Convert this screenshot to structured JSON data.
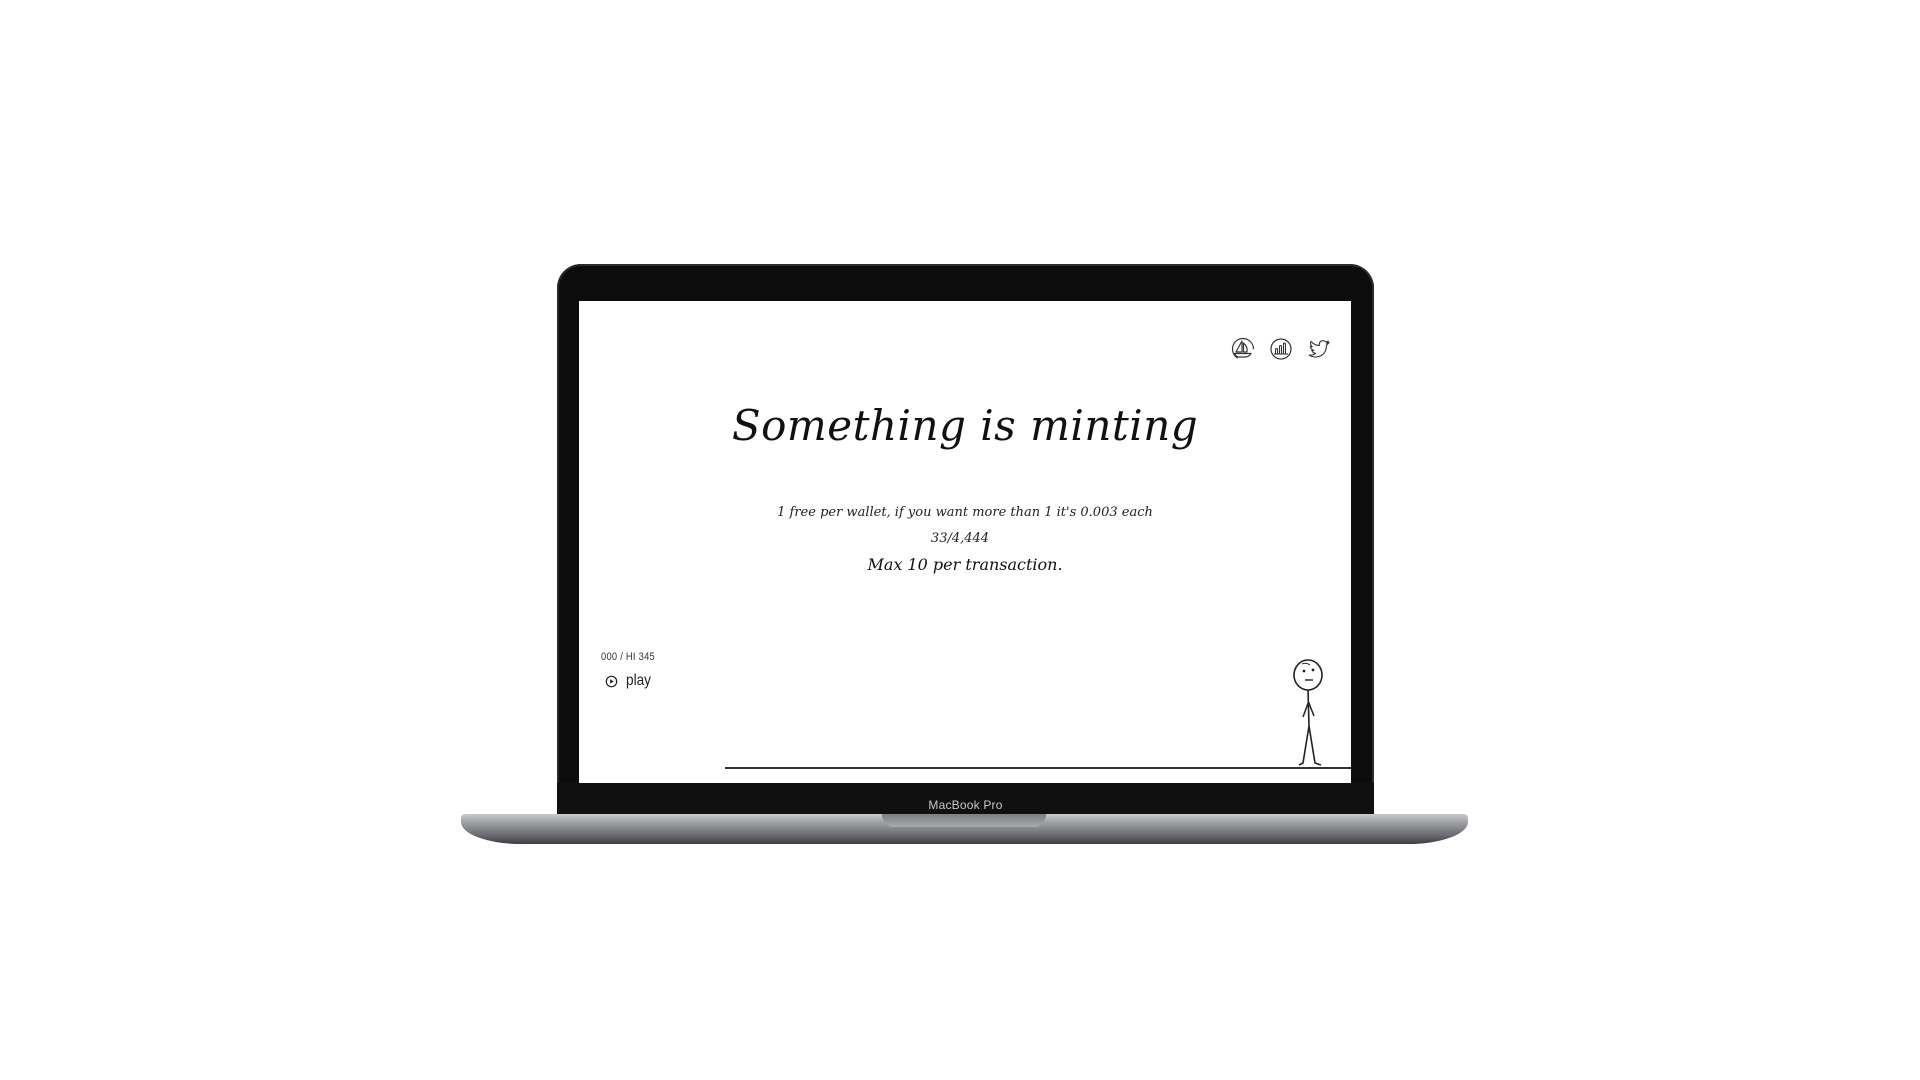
{
  "device": {
    "brand_label": "MacBook Pro"
  },
  "site": {
    "social_icons": [
      "opensea-icon",
      "stats-icon",
      "twitter-icon"
    ],
    "headline": "Something is  minting",
    "price_note": "1 free per wallet, if you want more than 1 it's 0.003 each",
    "minted_count": "33/4,444",
    "max_note": "Max 10 per transaction.",
    "game": {
      "score": "000 / HI 345",
      "play_label": "play"
    }
  }
}
